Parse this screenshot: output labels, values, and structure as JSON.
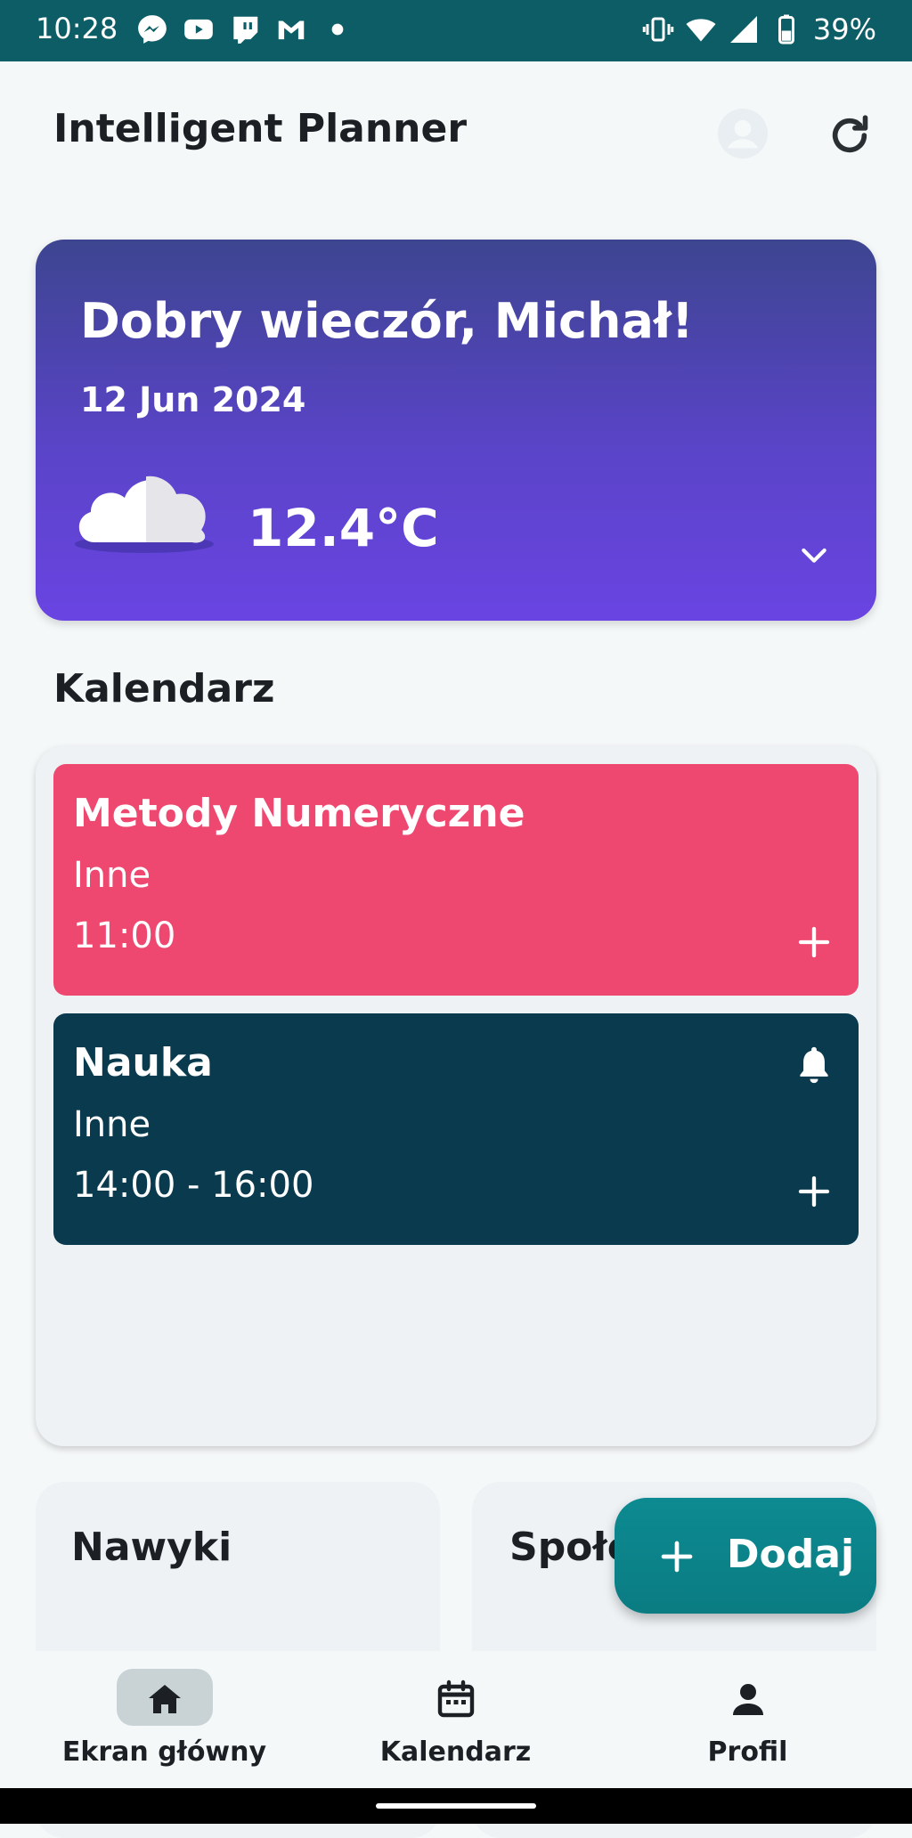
{
  "status_bar": {
    "time": "10:28",
    "notification_icons": [
      "messenger-icon",
      "youtube-icon",
      "twitch-icon",
      "gmail-icon",
      "dot-icon"
    ],
    "right_icons": [
      "vibrate-icon",
      "wifi-icon",
      "signal-icon",
      "battery-icon"
    ],
    "battery": "39%"
  },
  "app_bar": {
    "title": "Intelligent Planner",
    "icons": [
      "avatar-icon",
      "refresh-icon"
    ]
  },
  "weather_card": {
    "greeting": "Dobry wieczór, Michał!",
    "date": "12 Jun 2024",
    "temperature": "12.4°C",
    "weather_icon": "cloud-icon",
    "expand_icon": "chevron-down-icon",
    "gradient": [
      "#3d4590",
      "#6a44e2"
    ]
  },
  "calendar": {
    "section_title": "Kalendarz",
    "events": [
      {
        "title": "Metody Numeryczne",
        "category": "Inne",
        "time": "11:00",
        "color": "#ef4870",
        "has_bell": false
      },
      {
        "title": "Nauka",
        "category": "Inne",
        "time": "14:00 - 16:00",
        "color": "#0a3a4e",
        "has_bell": true
      }
    ]
  },
  "cards": {
    "habits_title": "Nawyki",
    "social_title": "Społeczność"
  },
  "fab": {
    "label": "Dodaj",
    "color": "#0a8a90"
  },
  "bottom_nav": {
    "items": [
      {
        "label": "Ekran główny",
        "icon": "home-icon",
        "active": true
      },
      {
        "label": "Kalendarz",
        "icon": "calendar-icon",
        "active": false
      },
      {
        "label": "Profil",
        "icon": "person-icon",
        "active": false
      }
    ]
  }
}
